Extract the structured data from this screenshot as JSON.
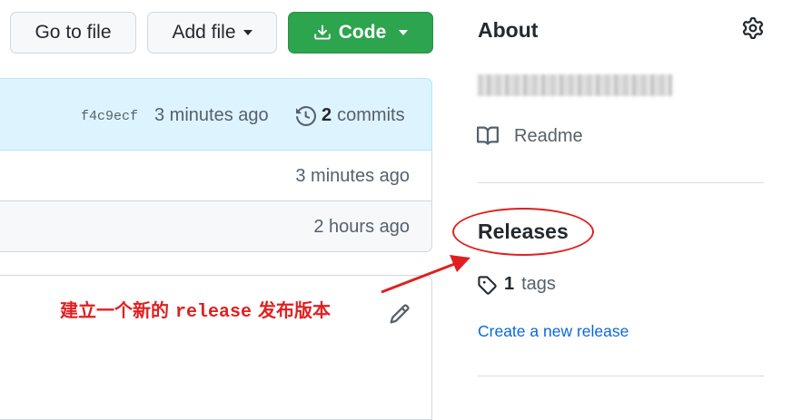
{
  "toolbar": {
    "go_to_file": "Go to file",
    "add_file": "Add file",
    "code": "Code"
  },
  "commit_bar": {
    "sha": "f4c9ecf",
    "time": "3 minutes ago",
    "commit_count": "2",
    "commits_label": "commits"
  },
  "files": [
    {
      "time": "3 minutes ago"
    },
    {
      "time": "2 hours ago"
    }
  ],
  "annotation": {
    "part1": "建立一个新的",
    "part2": "release",
    "part3": "发布版本",
    "color": "#e02020"
  },
  "about": {
    "title": "About",
    "readme": "Readme"
  },
  "releases": {
    "title": "Releases",
    "tag_count": "1",
    "tags_label": "tags",
    "create_link": "Create a new release"
  },
  "colors": {
    "code_button": "#2da44e",
    "link": "#0969da",
    "commit_bar": "#ddf4ff"
  }
}
